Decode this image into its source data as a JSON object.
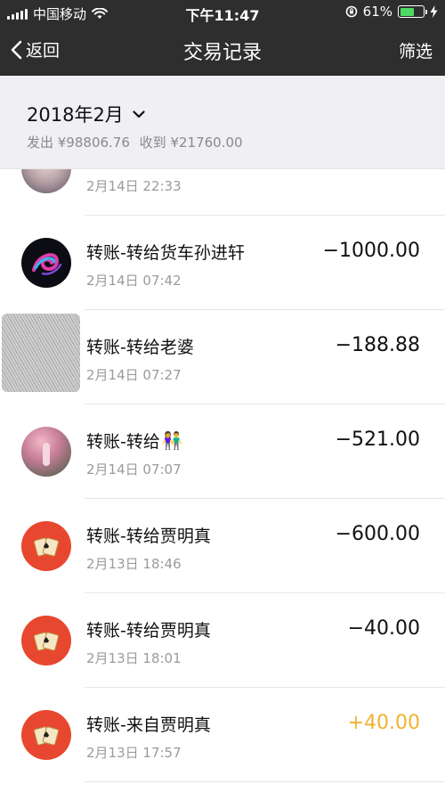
{
  "status_bar": {
    "carrier": "中国移动",
    "time": "下午11:47",
    "battery": "61%",
    "battery_level": 0.61
  },
  "nav": {
    "back_label": "返回",
    "title": "交易记录",
    "filter_label": "筛选"
  },
  "summary": {
    "month": "2018年2月",
    "outgo": "发出 ¥98806.76",
    "income": "收到 ¥21760.00"
  },
  "transactions": [
    {
      "title": "",
      "date": "2月14日 22:33",
      "amount": "",
      "avatar": "photo-avatar"
    },
    {
      "title": "转账-转给货车孙进轩",
      "date": "2月14日 07:42",
      "amount": "−1000.00",
      "avatar": "swirl-avatar"
    },
    {
      "title": "转账-转给老婆",
      "date": "2月14日 07:27",
      "amount": "−188.88",
      "avatar": "sketch-avatar"
    },
    {
      "title": "转账-转给",
      "emoji": "👫",
      "date": "2月14日 07:07",
      "amount": "−521.00",
      "avatar": "photo-avatar"
    },
    {
      "title": "转账-转给贾明真",
      "date": "2月13日 18:46",
      "amount": "−600.00",
      "avatar": "poker-cards-avatar"
    },
    {
      "title": "转账-转给贾明真",
      "date": "2月13日 18:01",
      "amount": "−40.00",
      "avatar": "poker-cards-avatar"
    },
    {
      "title": "转账-来自贾明真",
      "date": "2月13日 17:57",
      "amount": "+40.00",
      "avatar": "poker-cards-avatar"
    }
  ],
  "colors": {
    "bar_bg": "#2e2e2e",
    "summary_bg": "#efeff4",
    "income": "#f0b22d",
    "poker_avatar_bg": "#e8472f"
  }
}
